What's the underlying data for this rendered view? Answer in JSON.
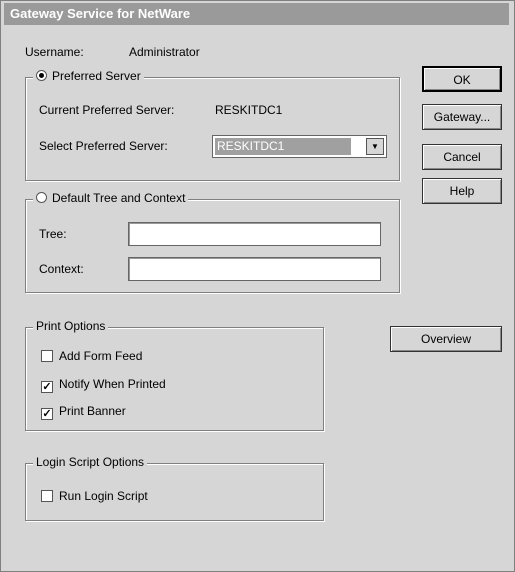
{
  "window": {
    "title": "Gateway Service for NetWare"
  },
  "username": {
    "label": "Username:",
    "value": "Administrator"
  },
  "preferred_server": {
    "radio_label": "Preferred Server",
    "selected": true,
    "current_label": "Current Preferred Server:",
    "current_value": "RESKITDC1",
    "select_label": "Select Preferred Server:",
    "select_value": "RESKITDC1"
  },
  "default_tree": {
    "radio_label": "Default Tree and Context",
    "selected": false,
    "tree_label": "Tree:",
    "tree_value": "",
    "context_label": "Context:",
    "context_value": ""
  },
  "print_options": {
    "legend": "Print Options",
    "items": [
      {
        "label": "Add Form Feed",
        "checked": false
      },
      {
        "label": "Notify When Printed",
        "checked": true
      },
      {
        "label": "Print Banner",
        "checked": true
      }
    ]
  },
  "login_script": {
    "legend": "Login Script Options",
    "items": [
      {
        "label": "Run Login Script",
        "checked": false
      }
    ]
  },
  "buttons": {
    "ok": "OK",
    "gateway": "Gateway...",
    "cancel": "Cancel",
    "help": "Help",
    "overview": "Overview"
  }
}
